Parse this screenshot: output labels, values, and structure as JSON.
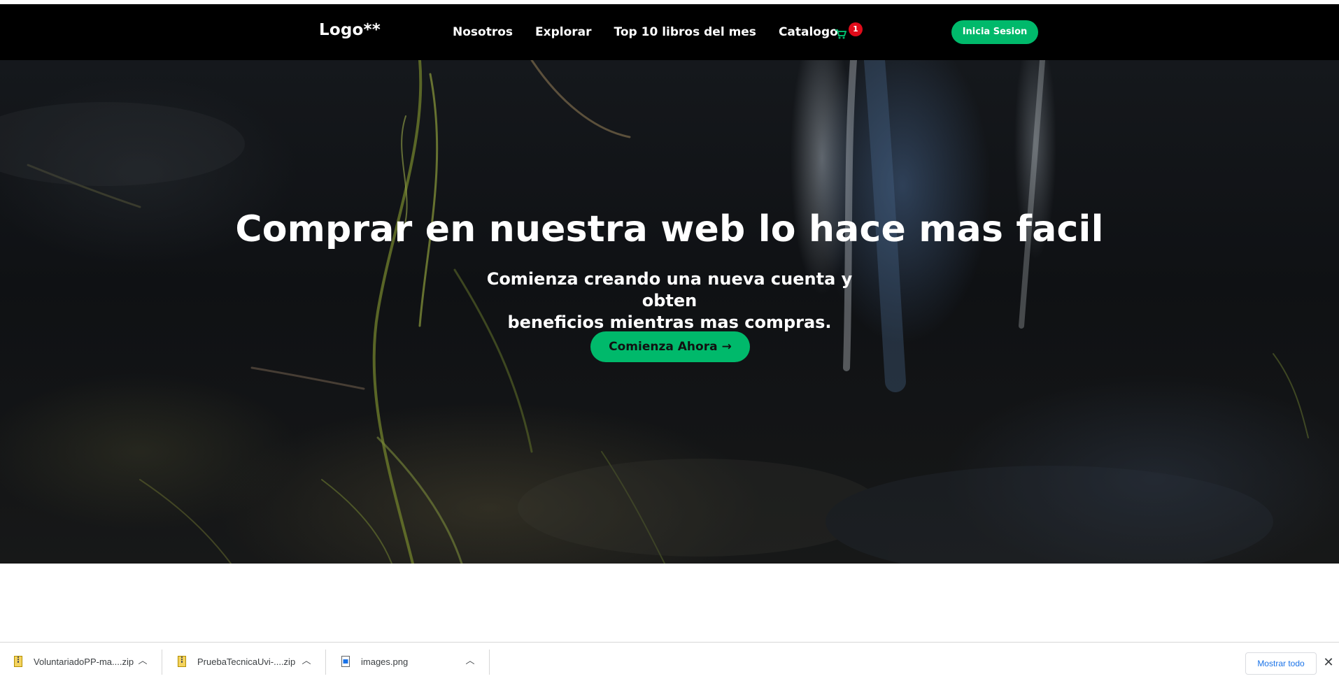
{
  "nav": {
    "logo": "Logo**",
    "links": [
      "Nosotros",
      "Explorar",
      "Top 10 libros del mes",
      "Catalogo"
    ],
    "cart_count": "1",
    "login_label": "Inicia Sesion"
  },
  "hero": {
    "title": "Comprar en nuestra web lo hace mas facil",
    "subtitle_line1": "Comienza creando una nueva cuenta y obten",
    "subtitle_line2": "beneficios mientras mas compras.",
    "cta_label": "Comienza Ahora"
  },
  "downloads": {
    "items": [
      {
        "name": "VoluntariadoPP-ma....zip",
        "icon": "zip-file-icon"
      },
      {
        "name": "PruebaTecnicaUvi-....zip",
        "icon": "zip-file-icon"
      },
      {
        "name": "images.png",
        "icon": "image-file-icon"
      }
    ],
    "show_all_label": "Mostrar todo"
  },
  "colors": {
    "accent": "#00b96b",
    "badge": "#e00b1a",
    "navbar": "#000000"
  }
}
